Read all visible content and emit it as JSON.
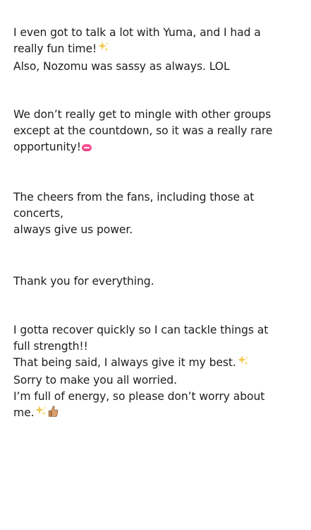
{
  "paragraphs": [
    {
      "lines": [
        {
          "text": "I even got to talk a lot with Yuma, and I had a"
        },
        {
          "text": "really fun time!",
          "emoji": "sparkles-icon"
        },
        {
          "text": "Also, Nozomu was sassy as always. LOL"
        }
      ]
    },
    {
      "lines": [
        {
          "text": "We don’t really get to mingle with other groups"
        },
        {
          "text": "except at the countdown, so it was a really rare"
        },
        {
          "text": "opportunity!",
          "emoji": "lips-icon"
        }
      ]
    },
    {
      "lines": [
        {
          "text": "The cheers from the fans, including those at"
        },
        {
          "text": "concerts,"
        },
        {
          "text": "always give us power."
        }
      ]
    },
    {
      "lines": [
        {
          "text": "Thank you for everything."
        }
      ]
    },
    {
      "lines": [
        {
          "text": "I gotta recover quickly so I can tackle things at"
        },
        {
          "text": "full strength!!"
        },
        {
          "text": "That being said, I always give it my best.",
          "emoji": "sparkles-icon"
        },
        {
          "text": "Sorry to make you all worried."
        },
        {
          "text": "I’m full of energy, so please don’t worry about"
        },
        {
          "text": "me.",
          "emoji": "sparkles-thumbs-up-icon"
        }
      ]
    }
  ]
}
